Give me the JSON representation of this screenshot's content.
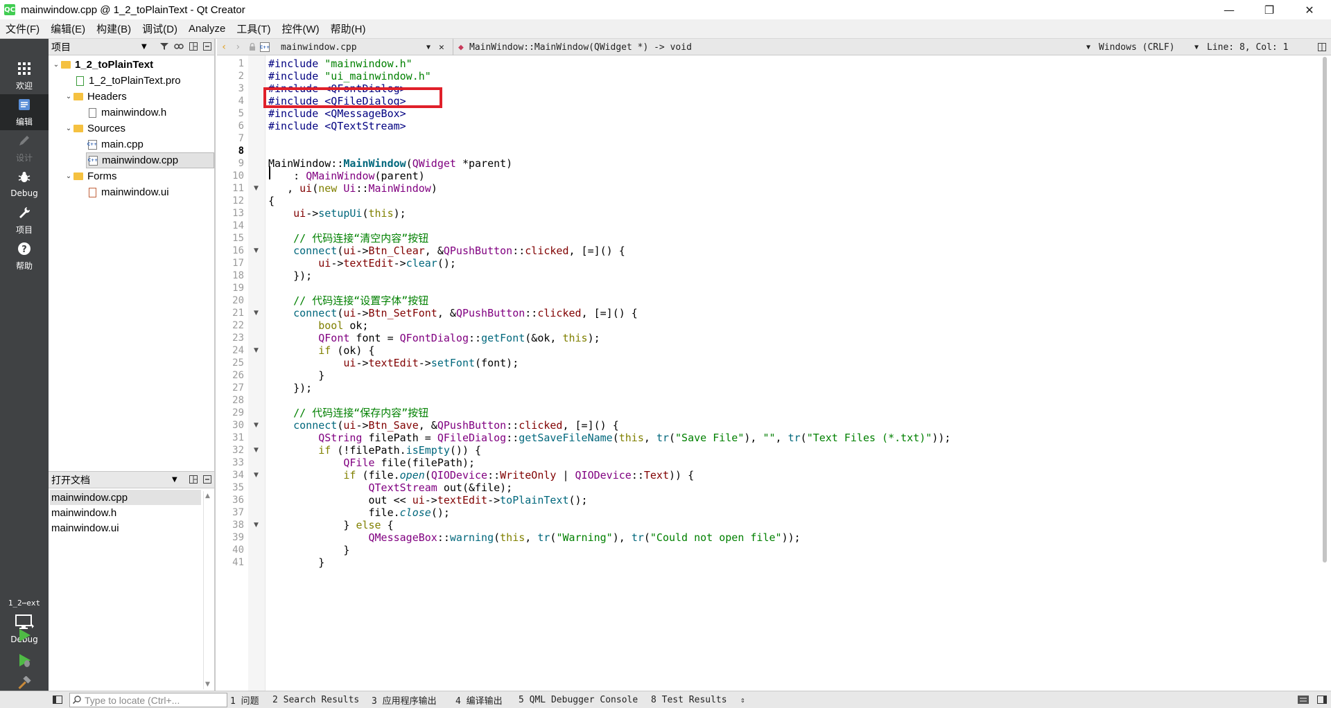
{
  "window": {
    "title": "mainwindow.cpp @ 1_2_toPlainText - Qt Creator",
    "app_icon": "QC",
    "minimize": "—",
    "restore": "❐",
    "close": "✕"
  },
  "menu": [
    "文件(F)",
    "编辑(E)",
    "构建(B)",
    "调试(D)",
    "Analyze",
    "工具(T)",
    "控件(W)",
    "帮助(H)"
  ],
  "modes": {
    "welcome": "欢迎",
    "edit": "编辑",
    "design": "设计",
    "debug": "Debug",
    "project": "项目",
    "help": "帮助"
  },
  "kit": {
    "project_short": "1_2⋯ext",
    "config": "Debug"
  },
  "sidebar": {
    "title": "项目",
    "tree": {
      "root": "1_2_toPlainText",
      "pro": "1_2_toPlainText.pro",
      "headers": "Headers",
      "header_file": "mainwindow.h",
      "sources": "Sources",
      "main_cpp": "main.cpp",
      "mainwindow_cpp": "mainwindow.cpp",
      "forms": "Forms",
      "ui_file": "mainwindow.ui"
    },
    "open_docs_title": "打开文档",
    "open_docs": [
      "mainwindow.cpp",
      "mainwindow.h",
      "mainwindow.ui"
    ]
  },
  "editor_toolbar": {
    "file": "mainwindow.cpp",
    "symbol": "MainWindow::MainWindow(QWidget *) -> void",
    "encoding": "Windows (CRLF)",
    "position": "Line: 8, Col: 1"
  },
  "current_line": 8,
  "status": {
    "locator_placeholder": "Type to locate (Ctrl+...",
    "tabs": [
      "1 问题",
      "2 Search Results",
      "3 应用程序输出",
      "4 编译输出",
      "5 QML Debugger Console",
      "8 Test Results"
    ]
  },
  "code_lines": [
    "#include \"mainwindow.h\"",
    "#include \"ui_mainwindow.h\"",
    "#include <QFontDialog>",
    "#include <QFileDialog>",
    "#include <QMessageBox>",
    "#include <QTextStream>",
    "",
    "",
    "MainWindow::MainWindow(QWidget *parent)",
    "    : QMainWindow(parent)",
    "   , ui(new Ui::MainWindow)",
    "{",
    "    ui->setupUi(this);",
    "",
    "    // 代码连接“清空内容”按钮",
    "    connect(ui->Btn_Clear, &QPushButton::clicked, [=]() {",
    "        ui->textEdit->clear();",
    "    });",
    "",
    "    // 代码连接“设置字体”按钮",
    "    connect(ui->Btn_SetFont, &QPushButton::clicked, [=]() {",
    "        bool ok;",
    "        QFont font = QFontDialog::getFont(&ok, this);",
    "        if (ok) {",
    "            ui->textEdit->setFont(font);",
    "        }",
    "    });",
    "",
    "    // 代码连接“保存内容”按钮",
    "    connect(ui->Btn_Save, &QPushButton::clicked, [=]() {",
    "        QString filePath = QFileDialog::getSaveFileName(this, tr(\"Save File\"), \"\", tr(\"Text Files (*.txt)\"));",
    "        if (!filePath.isEmpty()) {",
    "            QFile file(filePath);",
    "            if (file.open(QIODevice::WriteOnly | QIODevice::Text)) {",
    "                QTextStream out(&file);",
    "                out << ui->textEdit->toPlainText();",
    "                file.close();",
    "            } else {",
    "                QMessageBox::warning(this, tr(\"Warning\"), tr(\"Could not open file\"));",
    "            }",
    "        }"
  ],
  "fold_lines": [
    11,
    16,
    21,
    24,
    30,
    32,
    34,
    38
  ],
  "colors": {
    "modebar": "#404244",
    "highlight_box": "#e0202a",
    "preprocessor": "#000080",
    "string": "#008000",
    "keyword": "#808000",
    "type": "#800080",
    "function": "#00677c"
  }
}
